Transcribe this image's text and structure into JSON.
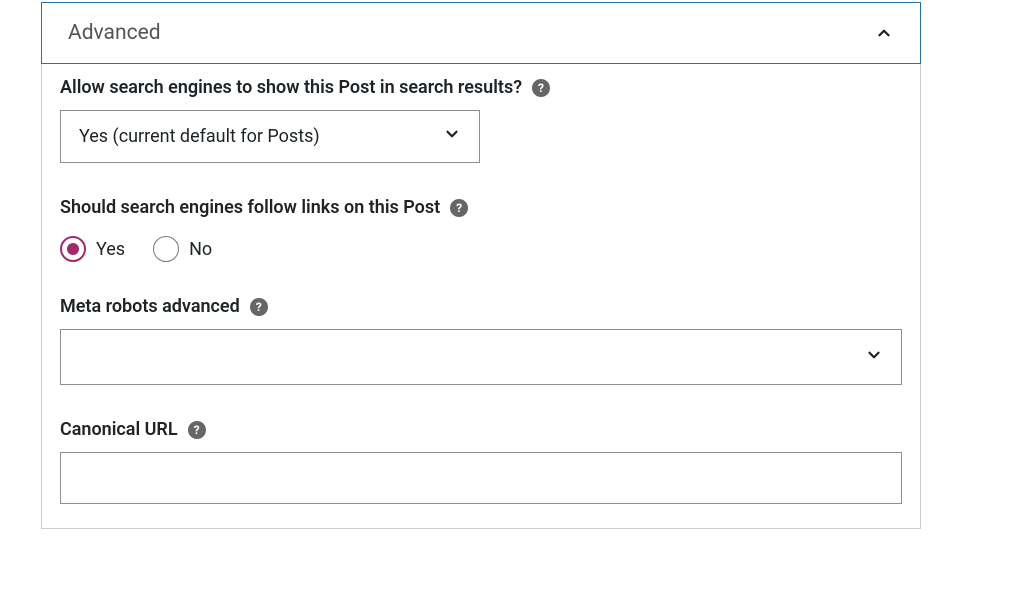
{
  "panel": {
    "title": "Advanced"
  },
  "fields": {
    "allow_search": {
      "label": "Allow search engines to show this Post in search results?",
      "selected": "Yes (current default for Posts)"
    },
    "follow_links": {
      "label": "Should search engines follow links on this Post",
      "options": {
        "yes": "Yes",
        "no": "No"
      },
      "selected": "yes"
    },
    "meta_robots": {
      "label": "Meta robots advanced",
      "value": ""
    },
    "canonical": {
      "label": "Canonical URL",
      "value": ""
    }
  },
  "colors": {
    "accent": "#a4286a",
    "focus_border": "#2271b1"
  }
}
